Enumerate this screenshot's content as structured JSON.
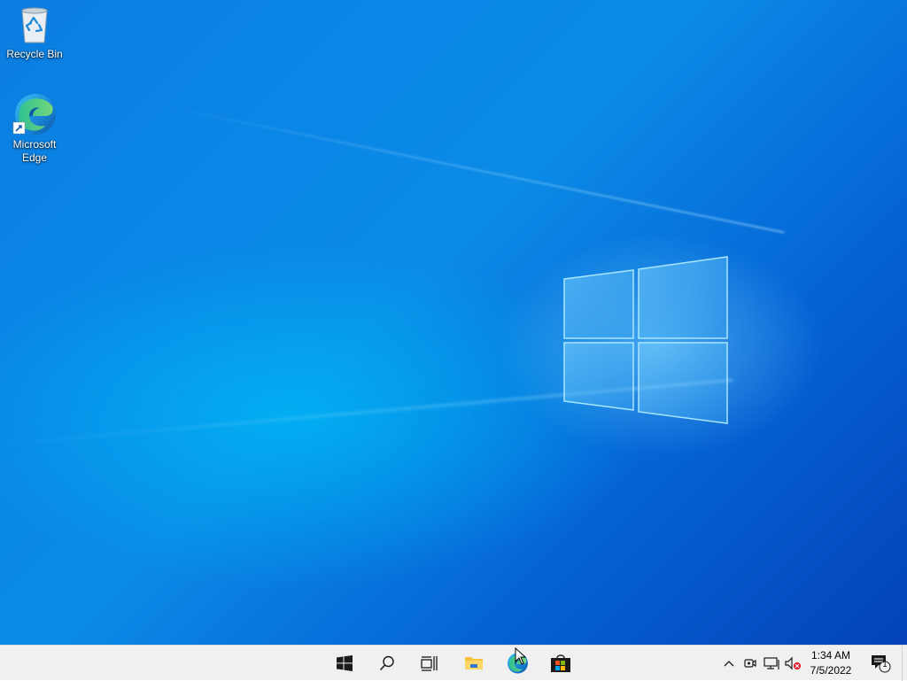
{
  "desktop": {
    "icons": [
      {
        "label": "Recycle Bin",
        "icon": "recycle-bin-icon"
      },
      {
        "label": "Microsoft Edge",
        "icon": "edge-icon",
        "shortcut": true
      }
    ]
  },
  "taskbar": {
    "buttons": [
      {
        "name": "start",
        "icon": "windows-logo-icon"
      },
      {
        "name": "search",
        "icon": "search-icon"
      },
      {
        "name": "task-view",
        "icon": "task-view-icon"
      },
      {
        "name": "file-explorer",
        "icon": "folder-icon"
      },
      {
        "name": "microsoft-edge",
        "icon": "edge-icon"
      },
      {
        "name": "microsoft-store",
        "icon": "store-icon"
      }
    ],
    "tray": {
      "icons": [
        "chevron-up-icon",
        "meet-now-icon",
        "network-icon",
        "volume-muted-icon"
      ],
      "time": "1:34 AM",
      "date": "7/5/2022",
      "notification_count": "1"
    }
  },
  "colors": {
    "accent": "#0078d7",
    "taskbar_bg": "#f0f0f0",
    "wallpaper": "#0a86e6"
  }
}
